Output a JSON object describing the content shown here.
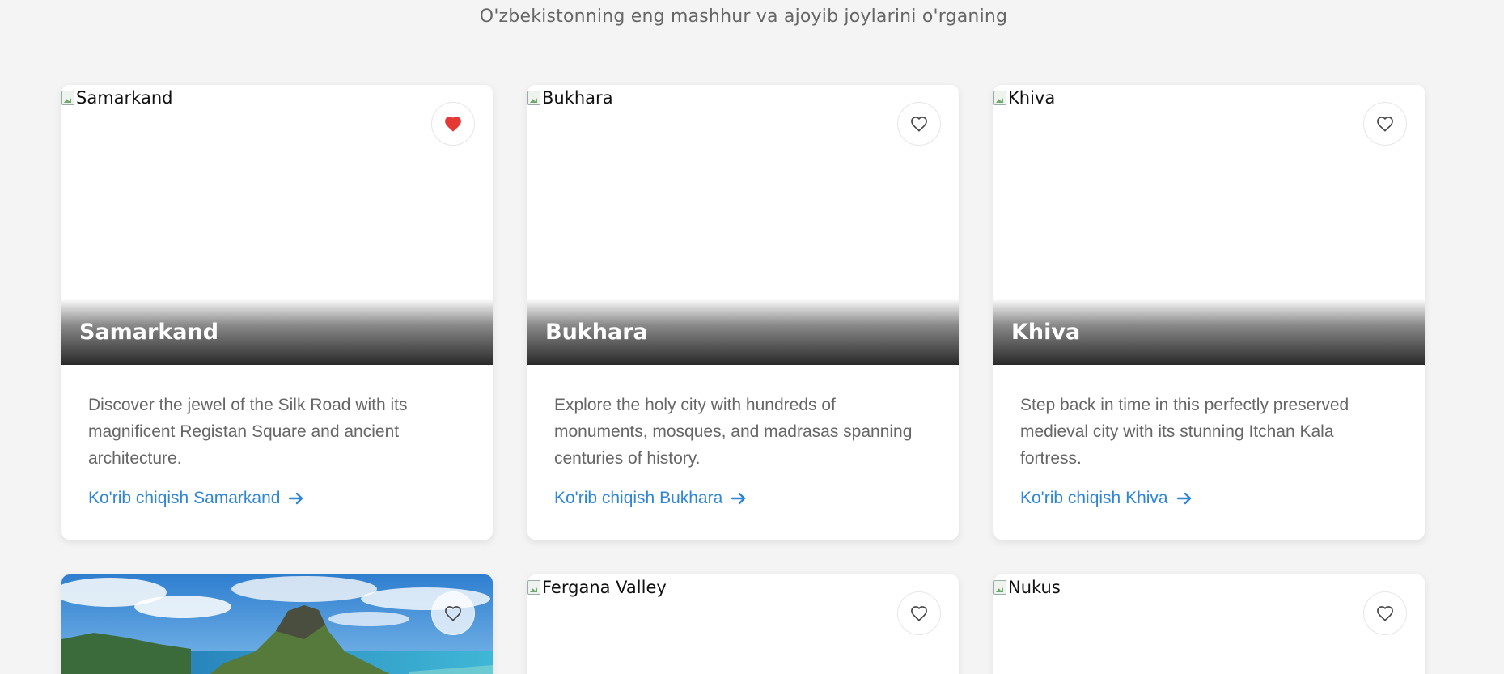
{
  "header": {
    "subtitle": "O'zbekistonning eng mashhur va ajoyib joylarini o'rganing"
  },
  "accent_color": "#2f86d8",
  "favorite_active_color": "#e53935",
  "cards": [
    {
      "image_alt": "Samarkand",
      "title": "Samarkand",
      "description": "Discover the jewel of the Silk Road with its magnificent Registan Square and ancient architecture.",
      "link": "Ko'rib chiqish Samarkand",
      "favorite": true
    },
    {
      "image_alt": "Bukhara",
      "title": "Bukhara",
      "description": "Explore the holy city with hundreds of monuments, mosques, and madrasas spanning centuries of history.",
      "link": "Ko'rib chiqish Bukhara",
      "favorite": false
    },
    {
      "image_alt": "Khiva",
      "title": "Khiva",
      "description": "Step back in time in this perfectly preserved medieval city with its stunning Itchan Kala fortress.",
      "link": "Ko'rib chiqish Khiva",
      "favorite": false
    },
    {
      "image_alt": "",
      "favorite": false
    },
    {
      "image_alt": "Fergana Valley",
      "favorite": false
    },
    {
      "image_alt": "Nukus",
      "favorite": false
    }
  ],
  "icons": {
    "favorite": "heart-icon",
    "link_arrow": "arrow-right-icon"
  }
}
